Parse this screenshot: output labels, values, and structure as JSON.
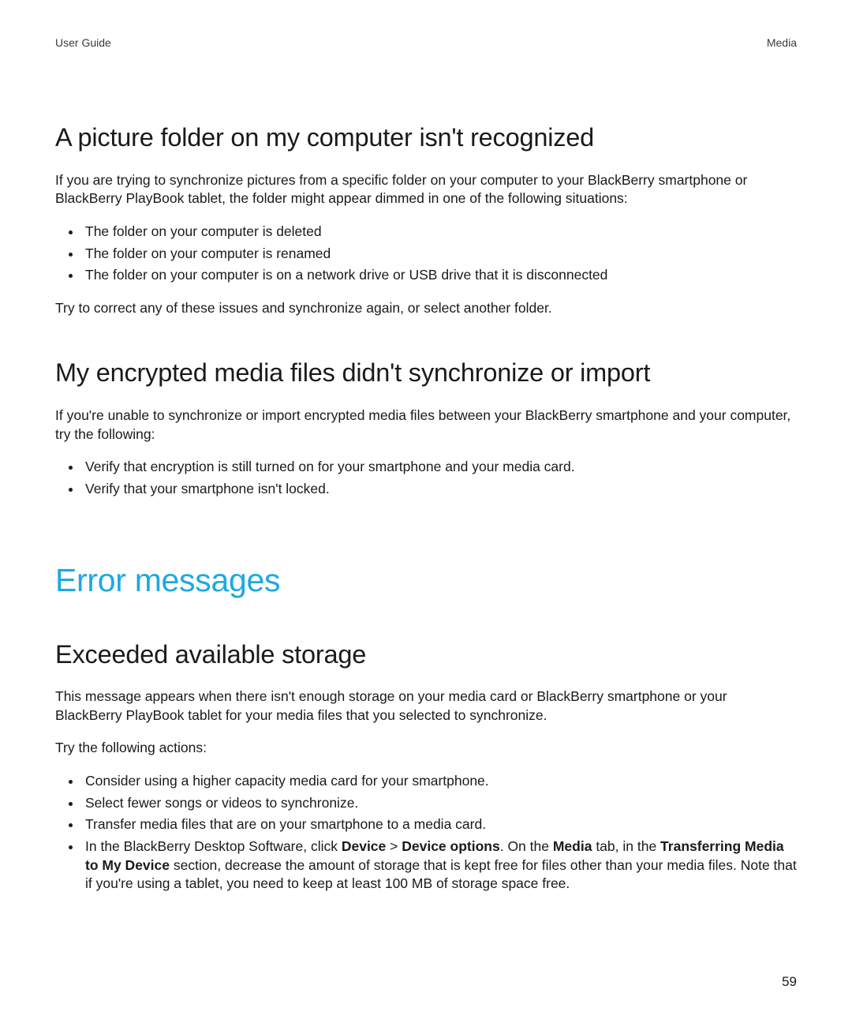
{
  "header": {
    "left": "User Guide",
    "right": "Media"
  },
  "section1": {
    "title": "A picture folder on my computer isn't recognized",
    "intro": "If you are trying to synchronize pictures from a specific folder on your computer to your BlackBerry smartphone or BlackBerry PlayBook tablet, the folder might appear dimmed in one of the following situations:",
    "bullets": [
      "The folder on your computer is deleted",
      "The folder on your computer is renamed",
      "The folder on your computer is on a network drive or USB drive that it is disconnected"
    ],
    "outro": "Try to correct any of these issues and synchronize again, or select another folder."
  },
  "section2": {
    "title": "My encrypted media files didn't synchronize or import",
    "intro": "If you're unable to synchronize or import encrypted media files between your BlackBerry smartphone and your computer, try the following:",
    "bullets": [
      "Verify that encryption is still turned on for your smartphone and your media card.",
      "Verify that your smartphone isn't locked."
    ]
  },
  "bigheading": "Error messages",
  "section3": {
    "title": "Exceeded available storage",
    "p1": "This message appears when there isn't enough storage on your media card or BlackBerry smartphone or your BlackBerry PlayBook tablet for your media files that you selected to synchronize.",
    "p2": "Try the following actions:",
    "bullets_plain": [
      "Consider using a higher capacity media card for your smartphone.",
      "Select fewer songs or videos to synchronize.",
      "Transfer media files that are on your smartphone to a media card."
    ],
    "bullet4": {
      "t0": "In the BlackBerry Desktop Software, click ",
      "b1": "Device",
      "t1": " > ",
      "b2": "Device options",
      "t2": ". On the ",
      "b3": "Media",
      "t3": " tab, in the ",
      "b4": "Transferring Media to My Device",
      "t4": " section, decrease the amount of storage that is kept free for files other than your media files. Note that if you're using a tablet, you need to keep at least 100 MB of storage space free."
    }
  },
  "page_number": "59"
}
